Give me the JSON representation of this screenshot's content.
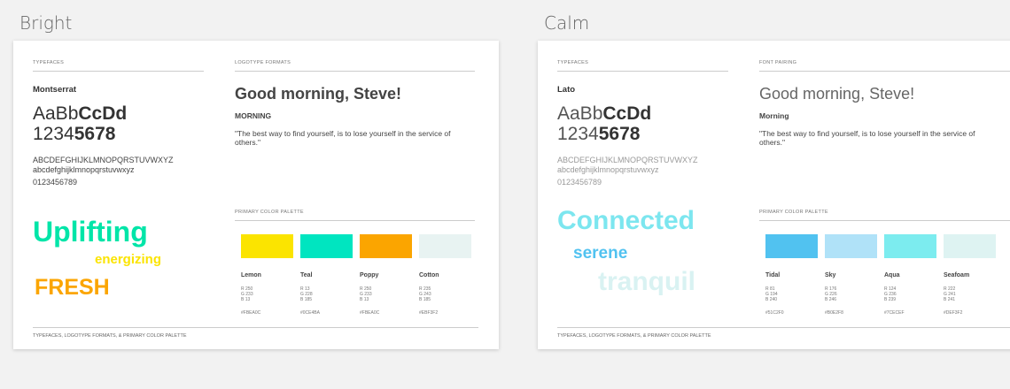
{
  "boards": [
    {
      "title": "Bright",
      "typefaces_label": "TYPEFACES",
      "right_label": "LOGOTYPE FORMATS",
      "face_name": "Montserrat",
      "sample_light": "AaBb",
      "sample_bold": "CcDd",
      "digits_light": "1234",
      "digits_bold": "5678",
      "upper": "ABCDEFGHIJKLMNOPQRSTUVWXYZ",
      "lower": "abcdefghijklmnopqrstuvwxyz",
      "numbers": "0123456789",
      "greeting": "Good morning, Steve!",
      "morning": "MORNING",
      "quote": "\"The best way to find yourself, is to lose yourself in the service of others.\"",
      "words": [
        {
          "text": "Uplifting",
          "color": "#00E5A8"
        },
        {
          "text": "energizing",
          "color": "#FBE400"
        },
        {
          "text": "FRESH",
          "color": "#FBA500"
        }
      ],
      "palette_label": "PRIMARY COLOR PALETTE",
      "swatches": [
        {
          "name": "Lemon",
          "color": "#FBE400",
          "rgb": "R 250\nG 233\nB 13",
          "hex": "#FBEA0C"
        },
        {
          "name": "Teal",
          "color": "#00E5C0",
          "rgb": "R 13\nG 228\nB 185",
          "hex": "#0CE4BA"
        },
        {
          "name": "Poppy",
          "color": "#FBA500",
          "rgb": "R 250\nG 233\nB 13",
          "hex": "#FBEA0C"
        },
        {
          "name": "Cotton",
          "color": "#E8F3F2",
          "rgb": "R 235\nG 243\nB 185",
          "hex": "#EBF3F2"
        }
      ],
      "footer": "TYPEFACES, LOGOTYPE FORMATS, & PRIMARY COLOR PALETTE"
    },
    {
      "title": "Calm",
      "typefaces_label": "TYPEFACES",
      "right_label": "FONT PAIRING",
      "face_name": "Lato",
      "sample_light": "AaBb",
      "sample_bold": "CcDd",
      "digits_light": "1234",
      "digits_bold": "5678",
      "upper": "ABCDEFGHIJKLMNOPQRSTUVWXYZ",
      "lower": "abcdefghijklmnopqrstuvwxyz",
      "numbers": "0123456789",
      "greeting": "Good morning, Steve!",
      "morning": "Morning",
      "quote": "\"The best way to find yourself, is to lose yourself in the service of others.\"",
      "words": [
        {
          "text": "Connected",
          "color": "#7CE6EF"
        },
        {
          "text": "serene",
          "color": "#51C2F0"
        },
        {
          "text": "tranquil",
          "color": "#D9F2F2"
        }
      ],
      "palette_label": "PRIMARY COLOR PALETTE",
      "swatches": [
        {
          "name": "Tidal",
          "color": "#51C2F0",
          "rgb": "R 81\nG 194\nB 240",
          "hex": "#51C2F0"
        },
        {
          "name": "Sky",
          "color": "#B0E2F8",
          "rgb": "R 176\nG 226\nB 246",
          "hex": "#B0E2F8"
        },
        {
          "name": "Aqua",
          "color": "#7CECEF",
          "rgb": "R 124\nG 236\nB 239",
          "hex": "#7CECEF"
        },
        {
          "name": "Seafoam",
          "color": "#DEF3F2",
          "rgb": "R 222\nG 241\nB 241",
          "hex": "#DEF3F2"
        }
      ],
      "footer": "TYPEFACES, LOGOTYPE FORMATS, & PRIMARY COLOR PALETTE"
    }
  ]
}
